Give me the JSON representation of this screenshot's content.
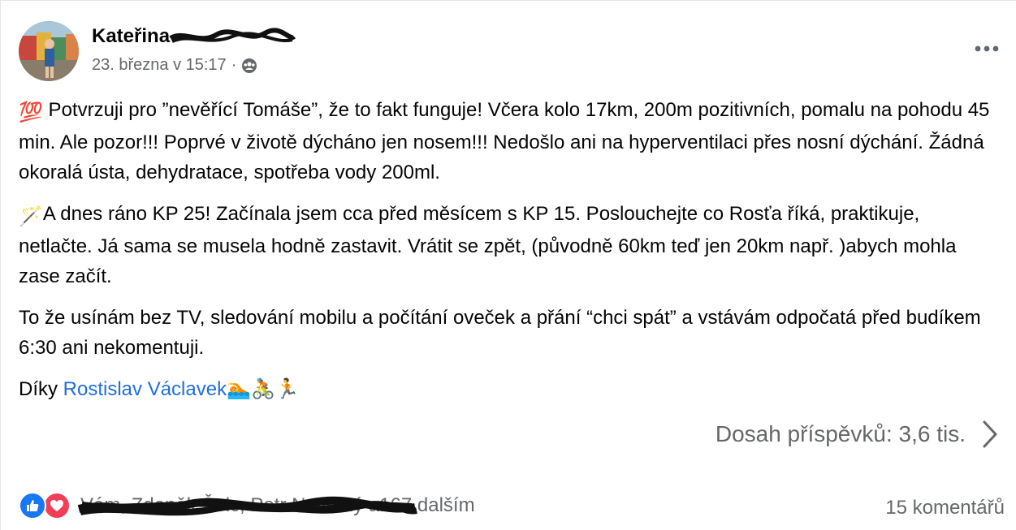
{
  "post": {
    "author": "Kateřina",
    "timestamp": "23. března v 15:17",
    "separator": "·",
    "audience_icon": "group-icon",
    "more_icon": "more-horizontal-icon",
    "paragraphs": {
      "p1": {
        "emoji": "💯",
        "text": " Potvrzuji pro ”nevěřící Tomáše”, že to fakt funguje! Včera kolo 17km, 200m pozitivních, pomalu na pohodu 45 min. Ale pozor!!! Poprvé v životě dýcháno jen nosem!!! Nedošlo ani na hyperventilaci přes nosní dýchání. Žádná okoralá ústa, dehydratace, spotřeba vody 200ml."
      },
      "p2": {
        "emoji": "🪄",
        "text": "A dnes ráno KP 25! Začínala jsem cca před měsícem s KP 15. Poslouchejte co Rosťa říká, praktikuje, netlačte. Já sama se musela hodně zastavit. Vrátit se zpět, (původně 60km teď jen 20km např. )abych mohla zase začít."
      },
      "p3": {
        "text": "To že usínám bez TV, sledování mobilu a počítání oveček a přání “chci spát” a vstávám odpočatá před budíkem 6:30 ani nekomentuji."
      },
      "p4": {
        "prefix": "Díky ",
        "mention": "Rostislav Václavek",
        "emojis": "🏊🚴🏃"
      }
    },
    "reach": {
      "label": "Dosah příspěvků: 3,6 tis.",
      "icon": "chevron-right-icon"
    },
    "reactions": {
      "like_icon": "like-icon",
      "love_icon": "love-icon",
      "names": "Vám, Zdeněk Šolc, Petr Novotný a",
      "others": " 167 dalším"
    },
    "comments": "15 komentářů"
  },
  "colors": {
    "text": "#050505",
    "secondary": "#65676b",
    "mention": "#216fdb",
    "like": "#1877f2",
    "love": "#f33e58"
  }
}
